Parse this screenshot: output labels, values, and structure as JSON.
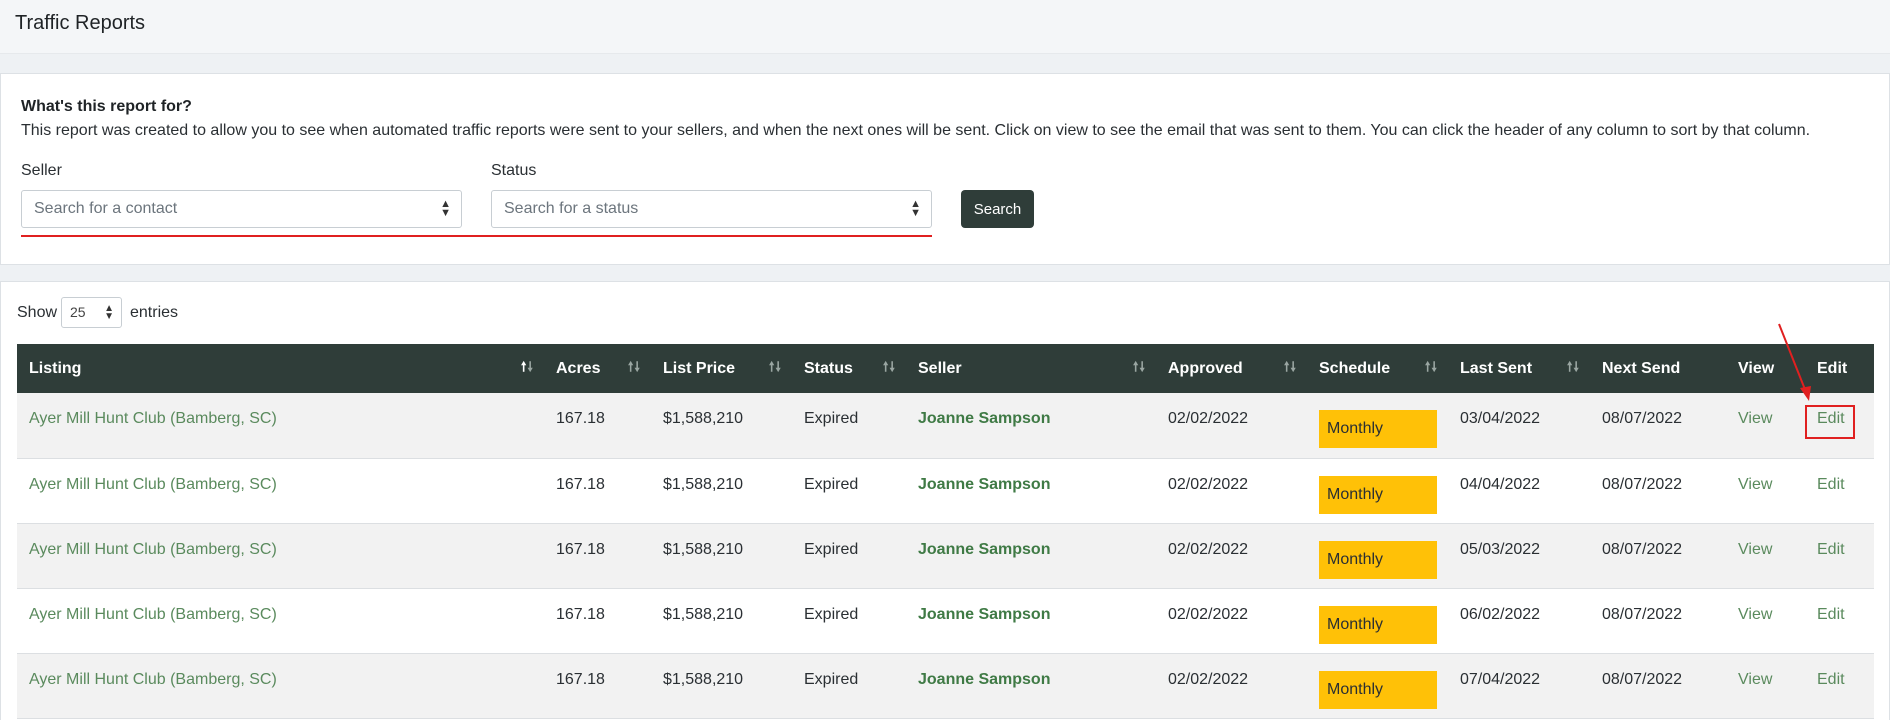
{
  "header": {
    "title": "Traffic Reports"
  },
  "info": {
    "heading": "What's this report for?",
    "text": "This report was created to allow you to see when automated traffic reports were sent to your sellers, and when the next ones will be sent. Click on view to see the email that was sent to them. You can click the header of any column to sort by that column."
  },
  "filters": {
    "seller_label": "Seller",
    "seller_placeholder": "Search for a contact",
    "status_label": "Status",
    "status_placeholder": "Search for a status",
    "search_button": "Search"
  },
  "table_controls": {
    "show_label": "Show",
    "page_size": "25",
    "entries_label": "entries"
  },
  "table": {
    "columns": [
      "Listing",
      "Acres",
      "List Price",
      "Status",
      "Seller",
      "Approved",
      "Schedule",
      "Last Sent",
      "Next Send",
      "View",
      "Edit"
    ],
    "rows": [
      {
        "listing": "Ayer Mill Hunt Club (Bamberg, SC)",
        "acres": "167.18",
        "list_price": "$1,588,210",
        "status": "Expired",
        "seller": "Joanne Sampson",
        "approved": "02/02/2022",
        "schedule": "Monthly",
        "last_sent": "03/04/2022",
        "next_send": "08/07/2022",
        "view": "View",
        "edit": "Edit"
      },
      {
        "listing": "Ayer Mill Hunt Club (Bamberg, SC)",
        "acres": "167.18",
        "list_price": "$1,588,210",
        "status": "Expired",
        "seller": "Joanne Sampson",
        "approved": "02/02/2022",
        "schedule": "Monthly",
        "last_sent": "04/04/2022",
        "next_send": "08/07/2022",
        "view": "View",
        "edit": "Edit"
      },
      {
        "listing": "Ayer Mill Hunt Club (Bamberg, SC)",
        "acres": "167.18",
        "list_price": "$1,588,210",
        "status": "Expired",
        "seller": "Joanne Sampson",
        "approved": "02/02/2022",
        "schedule": "Monthly",
        "last_sent": "05/03/2022",
        "next_send": "08/07/2022",
        "view": "View",
        "edit": "Edit"
      },
      {
        "listing": "Ayer Mill Hunt Club (Bamberg, SC)",
        "acres": "167.18",
        "list_price": "$1,588,210",
        "status": "Expired",
        "seller": "Joanne Sampson",
        "approved": "02/02/2022",
        "schedule": "Monthly",
        "last_sent": "06/02/2022",
        "next_send": "08/07/2022",
        "view": "View",
        "edit": "Edit"
      },
      {
        "listing": "Ayer Mill Hunt Club (Bamberg, SC)",
        "acres": "167.18",
        "list_price": "$1,588,210",
        "status": "Expired",
        "seller": "Joanne Sampson",
        "approved": "02/02/2022",
        "schedule": "Monthly",
        "last_sent": "07/04/2022",
        "next_send": "08/07/2022",
        "view": "View",
        "edit": "Edit"
      }
    ]
  },
  "colors": {
    "header_bg": "#2f3d39",
    "schedule_badge": "#ffc107",
    "link_green": "#5a8a5d",
    "annotation_red": "#e02020"
  }
}
